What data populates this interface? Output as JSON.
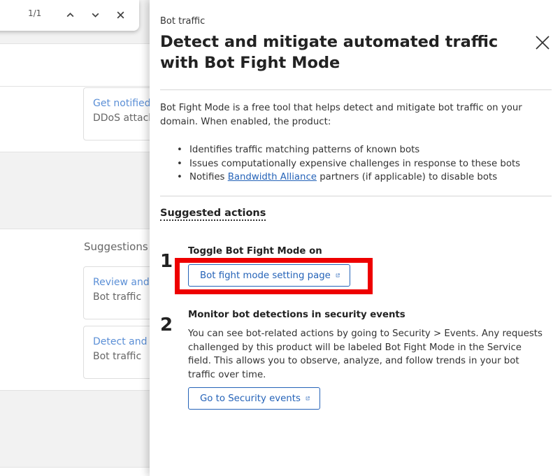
{
  "find_bar": {
    "count": "1/1"
  },
  "background": {
    "card_1": {
      "link": "Get notified",
      "sub": "DDoS attack"
    },
    "suggestions_label": "Suggestions",
    "card_2": {
      "link": "Review and l",
      "sub": "Bot traffic"
    },
    "card_3": {
      "link": "Detect and m",
      "sub": "Bot traffic"
    }
  },
  "panel": {
    "breadcrumb": "Bot traffic",
    "title": "Detect and mitigate automated traffic with Bot Fight Mode",
    "description": "Bot Fight Mode is a free tool that helps detect and mitigate bot traffic on your domain. When enabled, the product:",
    "bullets": {
      "b1": "Identifies traffic matching patterns of known bots",
      "b2": "Issues computationally expensive challenges in response to these bots",
      "b3_prefix": "Notifies ",
      "b3_link": "Bandwidth Alliance",
      "b3_suffix": " partners (if applicable) to disable bots"
    },
    "suggested_actions": "Suggested actions",
    "steps": [
      {
        "number": "1",
        "heading": "Toggle Bot Fight Mode on",
        "button": "Bot fight mode setting page"
      },
      {
        "number": "2",
        "heading": "Monitor bot detections in security events",
        "body": "You can see bot-related actions by going to Security > Events. Any requests challenged by this product will be labeled Bot Fight Mode in the Service field. This allows you to observe, analyze, and follow trends in your bot traffic over time.",
        "button": "Go to Security events"
      }
    ]
  },
  "colors": {
    "accent": "#2563b8",
    "highlight": "#ee0000"
  },
  "icons": {
    "close": "close-icon",
    "external": "external-link-icon",
    "up": "chevron-up-icon",
    "down": "chevron-down-icon"
  }
}
